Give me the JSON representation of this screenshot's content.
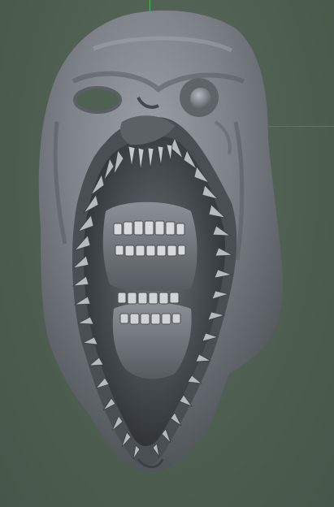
{
  "viewport": {
    "background": "#4f6152",
    "axis_colors": {
      "y_axis": "#3cc24a",
      "x_axis": "#e03a3a"
    }
  },
  "model": {
    "icon": "sculpted-creature-head-mesh",
    "surface_color": "#7f858a",
    "shadow_color": "#3a3f43"
  }
}
